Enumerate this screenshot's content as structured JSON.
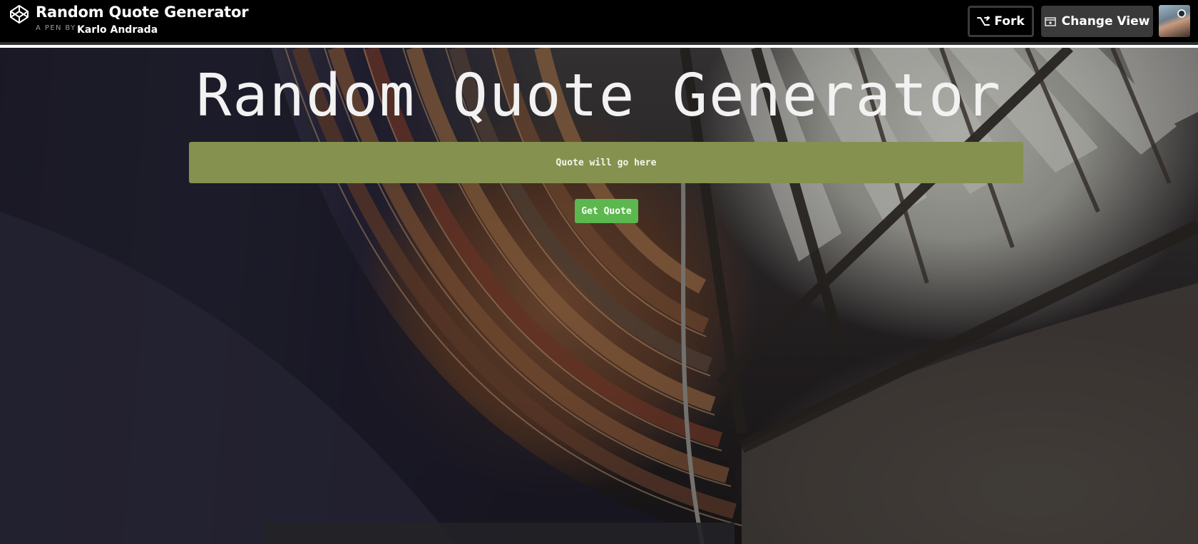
{
  "header": {
    "pen_title": "Random Quote Generator",
    "byline_prefix": "A PEN BY",
    "author": "Karlo Andrada",
    "fork_label": "Fork",
    "change_view_label": "Change View",
    "logo_icon": "codepen-logo-icon",
    "fork_icon": "fork-icon",
    "change_view_icon": "change-view-icon"
  },
  "main": {
    "title": "Random Quote Generator",
    "quote_text": "Quote will go here",
    "get_quote_label": "Get Quote"
  },
  "colors": {
    "topbar_bg": "#000000",
    "quote_box_bg": "#85914f",
    "get_quote_bg": "#5bb74e",
    "change_view_bg": "#3a3a3a"
  }
}
